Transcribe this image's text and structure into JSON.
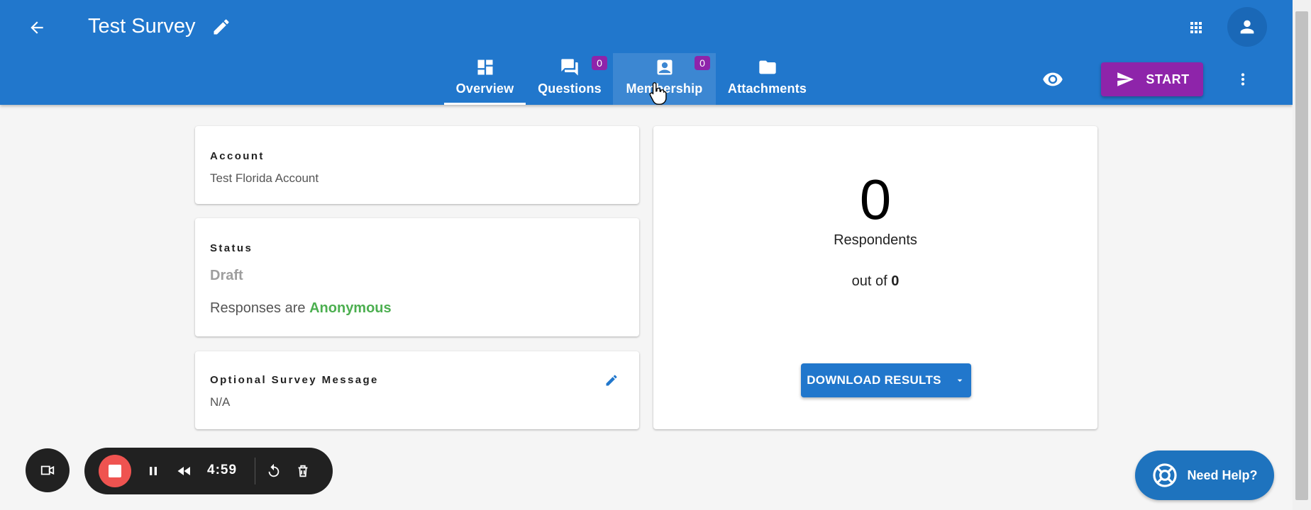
{
  "header": {
    "title": "Test Survey",
    "accent_color": "#2177cc"
  },
  "tabs": [
    {
      "label": "Overview",
      "icon": "dashboard-icon",
      "active": true
    },
    {
      "label": "Questions",
      "icon": "forum-icon",
      "badge": "0"
    },
    {
      "label": "Membership",
      "icon": "contact-icon",
      "badge": "0"
    },
    {
      "label": "Attachments",
      "icon": "folder-icon"
    }
  ],
  "actions": {
    "start_label": "START",
    "start_color": "#8e24aa"
  },
  "account": {
    "label": "Account",
    "value": "Test Florida Account"
  },
  "status": {
    "label": "Status",
    "value": "Draft",
    "responses_prefix": "Responses are",
    "responses_mode": "Anonymous"
  },
  "message": {
    "label": "Optional Survey Message",
    "value": "N/A"
  },
  "respondents": {
    "count": "0",
    "label": "Respondents",
    "out_of_prefix": "out of",
    "out_of_value": "0",
    "download_label": "DOWNLOAD RESULTS"
  },
  "recorder": {
    "time": "4:59"
  },
  "help": {
    "label": "Need Help?"
  }
}
